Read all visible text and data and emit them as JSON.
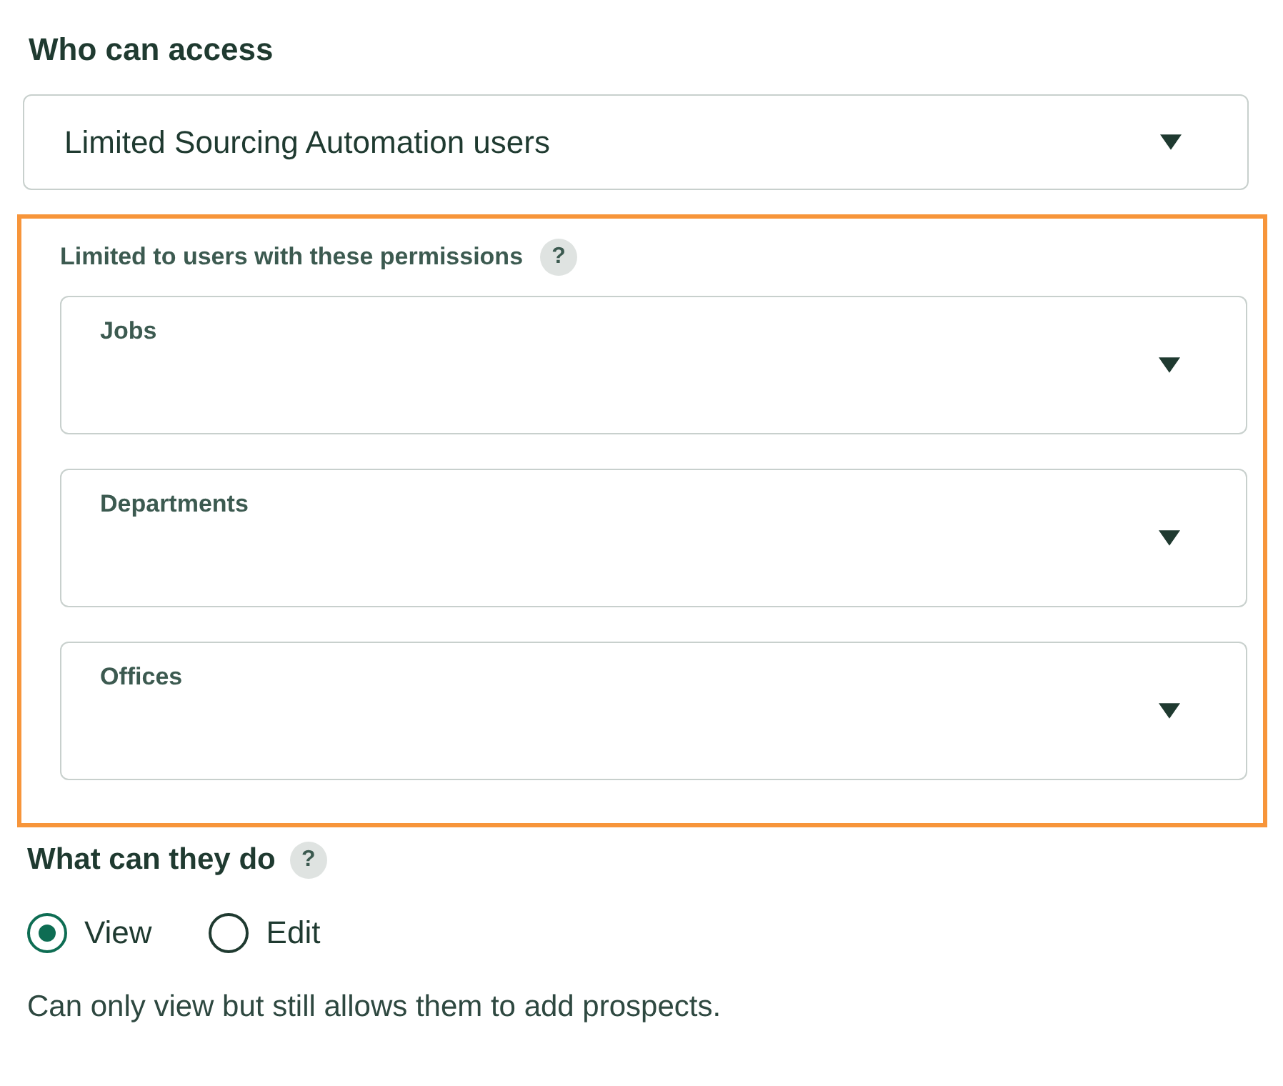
{
  "access": {
    "label": "Who can access",
    "select": {
      "value": "Limited Sourcing Automation users"
    }
  },
  "permissions": {
    "highlighted": true,
    "label": "Limited to users with these permissions",
    "help": "?",
    "fields": [
      {
        "label": "Jobs"
      },
      {
        "label": "Departments"
      },
      {
        "label": "Offices"
      }
    ]
  },
  "actions": {
    "label": "What can they do",
    "help": "?",
    "options": [
      {
        "label": "View",
        "selected": true
      },
      {
        "label": "Edit",
        "selected": false
      }
    ],
    "description": "Can only view but still allows them to add prospects."
  }
}
